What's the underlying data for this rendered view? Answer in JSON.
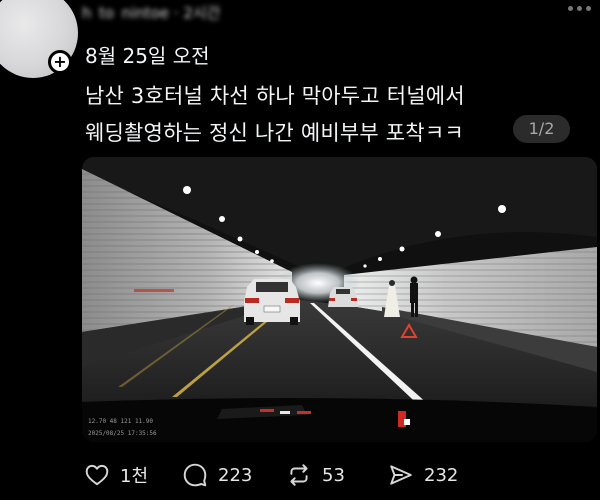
{
  "author": {
    "avatar_icon": "user-avatar-icon",
    "follow_icon": "plus-icon",
    "name_blurred": "h_to_nintoe · 2시간"
  },
  "post": {
    "date": "8월 25일 오전",
    "text_line1": "남산 3호터널 차선 하나 막아두고 터널에서",
    "text_line2": "웨딩촬영하는 정신 나간 예비부부 포착ㅋㅋ",
    "page_indicator": "1/2",
    "dashcam_overlay": {
      "top": "12.70    48    121    11.90",
      "bottom": "2025/08/25  17:35:56"
    }
  },
  "actions": {
    "likes": "1천",
    "comments": "223",
    "reposts": "53",
    "shares": "232"
  },
  "colors": {
    "background": "#000000",
    "text": "#f3f5f7",
    "muted": "#a8a8a8",
    "badge_bg": "#2b2b2b"
  }
}
